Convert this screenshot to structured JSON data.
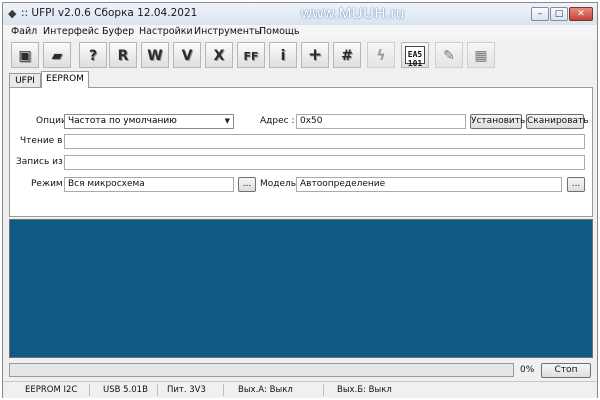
{
  "window": {
    "title": ":: UFPI v2.0.6 Сборка 12.04.2021",
    "watermark": "www.MUUH.ru",
    "controls": {
      "minimize": "–",
      "maximize": "□",
      "close": "✕"
    }
  },
  "menu": [
    "Файл",
    "Интерфейс",
    "Буфер",
    "Настройки",
    "Инструменты",
    "Помощь"
  ],
  "toolbar": {
    "buttons": [
      {
        "name": "save-icon",
        "glyph": "💾"
      },
      {
        "name": "open-folder-icon",
        "glyph": "📂"
      },
      {
        "name": "detect-chip-icon",
        "glyph": "?"
      },
      {
        "name": "read-icon",
        "glyph": "R"
      },
      {
        "name": "write-icon",
        "glyph": "W"
      },
      {
        "name": "verify-icon",
        "glyph": "V"
      },
      {
        "name": "erase-icon",
        "glyph": "X"
      },
      {
        "name": "fill-ff-icon",
        "glyph": "FF"
      },
      {
        "name": "info-icon",
        "glyph": "i"
      },
      {
        "name": "add-icon",
        "glyph": "+"
      },
      {
        "name": "checksum-icon",
        "glyph": "#"
      },
      {
        "name": "flash-icon",
        "glyph": "ϟ"
      },
      {
        "name": "ea5-101-icon",
        "glyph": "EA5\n101"
      },
      {
        "name": "edit-icon",
        "glyph": "✎"
      },
      {
        "name": "hex-grid-icon",
        "glyph": "▦"
      }
    ],
    "ea5_line1": "EA5",
    "ea5_line2": "101"
  },
  "tabs": [
    "UFPI",
    "EEPROM"
  ],
  "eeprom": {
    "options_label": "Опции :",
    "options_value": "Частота по умолчанию",
    "address_label": "Адрес :",
    "address_value": "0x50",
    "set_button": "Установить",
    "scan_button": "Сканировать",
    "read_to_label": "Чтение в :",
    "read_to_value": "",
    "write_from_label": "Запись из :",
    "write_from_value": "",
    "mode_label": "Режим :",
    "mode_value": "Вся микросхема",
    "browse_label": "...",
    "model_label": "Модель :",
    "model_value": "Автоопределение"
  },
  "progress": {
    "value": 0,
    "label": "0%",
    "stop_button": "Стоп"
  },
  "colors": {
    "log_background": "#0e5a82",
    "progress_fill": "#37b14c"
  },
  "statusbar": [
    "EEPROM I2C",
    "USB 5.01B",
    "Пит. 3V3",
    "Вых.А: Выкл",
    "Вых.Б: Выкл"
  ]
}
